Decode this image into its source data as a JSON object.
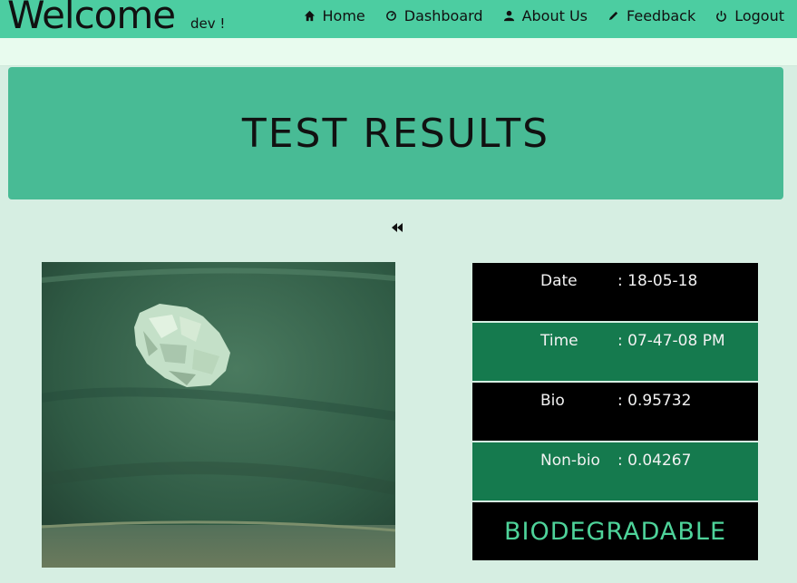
{
  "header": {
    "welcome": "Welcome",
    "user": "dev !",
    "nav": [
      {
        "label": "Home",
        "icon": "home-icon"
      },
      {
        "label": "Dashboard",
        "icon": "dashboard-icon"
      },
      {
        "label": "About Us",
        "icon": "user-icon"
      },
      {
        "label": "Feedback",
        "icon": "pencil-icon"
      },
      {
        "label": "Logout",
        "icon": "power-icon"
      }
    ]
  },
  "hero": {
    "title": "TEST RESULTS"
  },
  "back_icon": "double-chevron-left-icon",
  "results": {
    "date_label": "Date",
    "date_value": ": 18-05-18",
    "time_label": "Time",
    "time_value": ": 07-47-08 PM",
    "bio_label": "Bio",
    "bio_value": ": 0.95732",
    "nonbio_label": "Non-bio",
    "nonbio_value": ": 0.04267",
    "verdict": "BIODEGRADABLE"
  },
  "colors": {
    "topbar": "#4ccda1",
    "hero": "#48bb95",
    "row_green": "#157a4e",
    "verdict": "#4ed39a"
  }
}
